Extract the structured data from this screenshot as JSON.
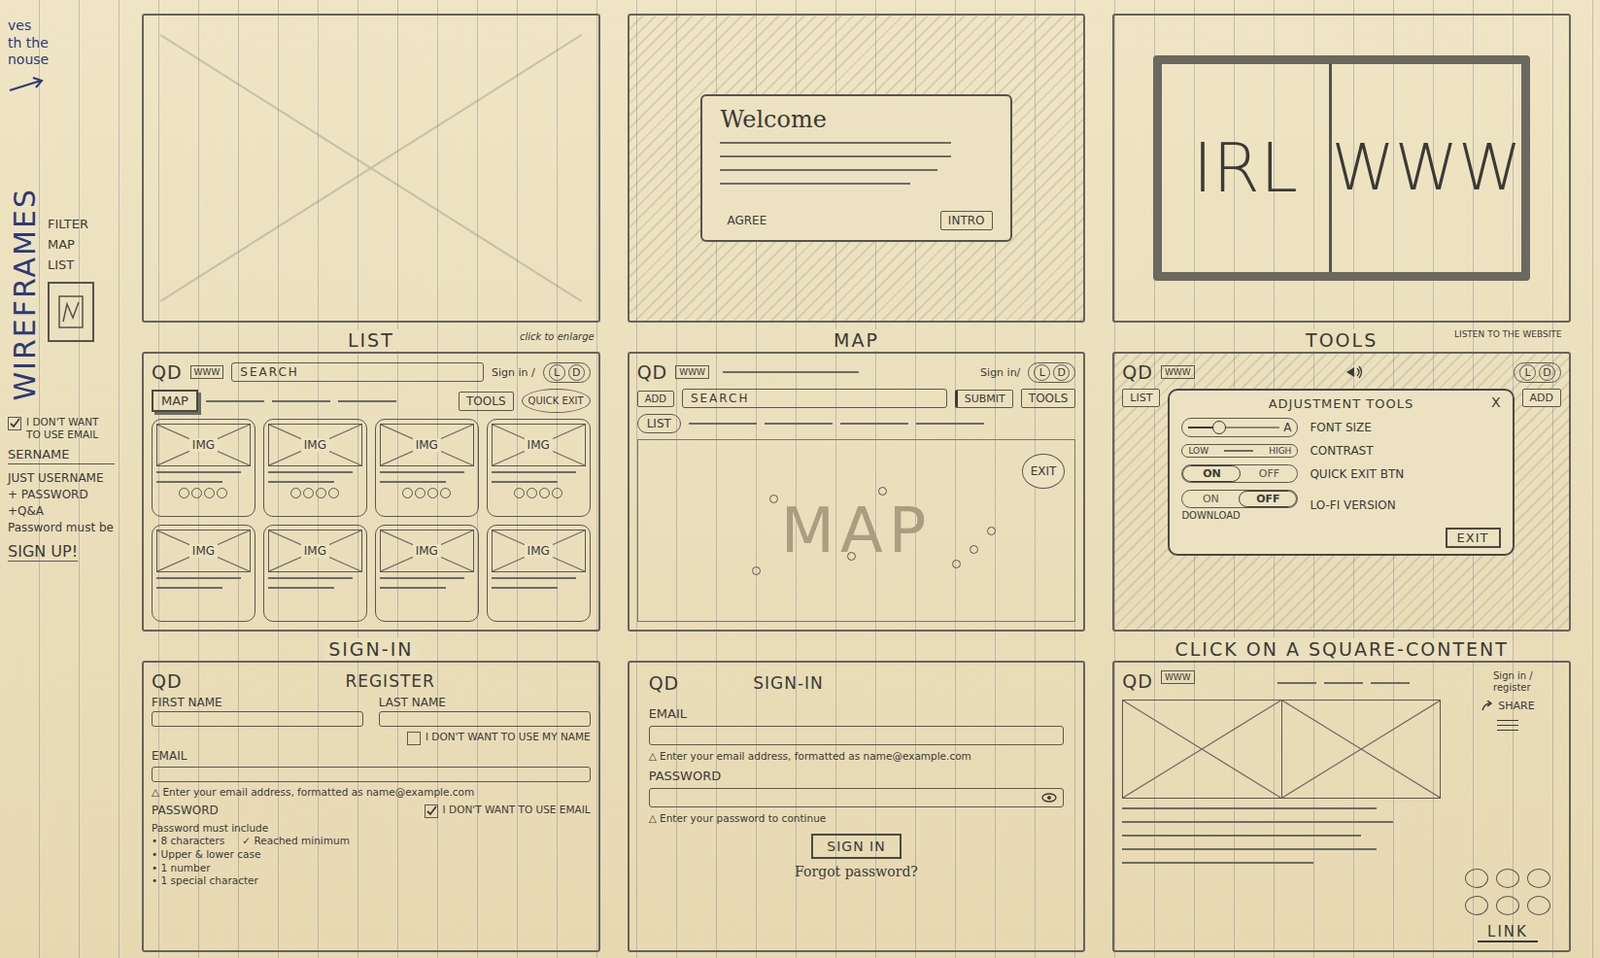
{
  "sheet": {
    "notes": [
      "ves",
      "th the",
      "nouse"
    ],
    "title": "WIREFRAMES",
    "filter": "FILTER",
    "map_list": [
      "MAP",
      "LIST"
    ],
    "option": {
      "label": "I DON'T WANT TO USE EMAIL",
      "checked": true
    },
    "username": "SERNAME",
    "extra": [
      "JUST USERNAME",
      "+ PASSWORD",
      "+Q&A",
      "Password must be"
    ],
    "signup": "SIGN UP!"
  },
  "welcome": {
    "title": "Welcome",
    "buttons": [
      "AGREE",
      "INTRO"
    ]
  },
  "splash": {
    "left": "IRL",
    "right": "WWW"
  },
  "list": {
    "caption": "LIST",
    "note": "click to enlarge",
    "logo": "QD",
    "www": "WWW",
    "search": "SEARCH",
    "signin": "Sign in /",
    "modes": [
      "L",
      "D"
    ],
    "tools": "TOOLS",
    "map": "MAP",
    "quick_exit": "QUICK EXIT",
    "cards": [
      "IMG",
      "IMG",
      "IMG",
      "IMG",
      "IMG",
      "IMG",
      "IMG",
      "IMG"
    ]
  },
  "map": {
    "caption": "MAP",
    "logo": "QD",
    "www": "WWW",
    "add": "ADD",
    "search": "SEARCH",
    "submit": "SUBMIT",
    "signin": "Sign in/",
    "modes": [
      "L",
      "D"
    ],
    "tools": "TOOLS",
    "list": "LIST",
    "watermark": "MAP",
    "exit": "EXIT"
  },
  "tools": {
    "caption": "TOOLS",
    "note": "LISTEN TO THE WEBSITE",
    "logo": "QD",
    "www": "WWW",
    "list": "LIST",
    "modes": [
      "L",
      "D"
    ],
    "add": "ADD",
    "panel": {
      "title": "ADJUSTMENT TOOLS",
      "close": "X",
      "rows": [
        {
          "kind": "slider",
          "mark": "A",
          "label": "FONT SIZE",
          "level": 0.35
        },
        {
          "kind": "range",
          "low": "LOW",
          "high": "HIGH",
          "label": "CONTRAST"
        },
        {
          "kind": "toggle",
          "on_text": "ON",
          "off_text": "OFF",
          "label": "QUICK EXIT BTN",
          "on": true
        },
        {
          "kind": "toggle",
          "on_text": "ON",
          "off_text": "OFF",
          "label": "LO-FI VERSION",
          "on": false,
          "sub": "DOWNLOAD"
        }
      ],
      "exit": "EXIT"
    }
  },
  "register": {
    "caption": "SIGN-IN",
    "logo": "QD",
    "title": "REGISTER",
    "first": "FIRST NAME",
    "last": "LAST NAME",
    "no_name": {
      "label": "I DON'T WANT TO USE MY NAME",
      "checked": false
    },
    "email": "EMAIL",
    "email_hint": "△ Enter your email address, formatted as name@example.com",
    "password": "PASSWORD",
    "no_email": {
      "label": "I DON'T WANT TO USE EMAIL",
      "checked": true
    },
    "rules_title": "Password must include",
    "rules": [
      "• 8 characters",
      "• Upper & lower case",
      "• 1 number",
      "• 1 special character"
    ],
    "reached": "✓ Reached minimum"
  },
  "signin": {
    "logo": "QD",
    "title": "SIGN-IN",
    "email": "EMAIL",
    "email_hint": "△ Enter your email address, formatted as name@example.com",
    "password": "PASSWORD",
    "password_hint": "△ Enter your password to continue",
    "button": "SIGN IN",
    "forgot": "Forgot password?"
  },
  "content": {
    "caption": "CLICK ON A SQUARE-CONTENT",
    "logo": "QD",
    "www": "WWW",
    "signin": "Sign in / register",
    "share": "SHARE",
    "link": "LINK"
  }
}
